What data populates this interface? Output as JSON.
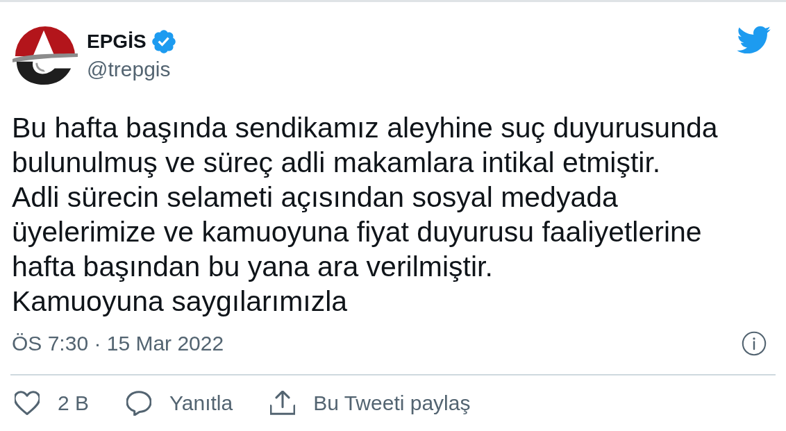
{
  "author": {
    "name": "EPGİS",
    "verified": true,
    "handle": "@trepgis"
  },
  "tweet": {
    "text_lines": [
      "Bu hafta başında sendikamız aleyhine suç duyurusunda",
      "bulunulmuş ve süreç adli makamlara intikal etmiştir.",
      "Adli sürecin selameti açısından sosyal medyada",
      "üyelerimize ve kamuoyuna fiyat duyurusu faaliyetlerine",
      "hafta başından bu yana ara verilmiştir.",
      "Kamuoyuna saygılarımızla"
    ],
    "timestamp": "ÖS 7:30 · 15 Mar 2022"
  },
  "actions": [
    {
      "kind": "like",
      "label": "2 B"
    },
    {
      "kind": "reply",
      "label": "Yanıtla"
    },
    {
      "kind": "share",
      "label": "Bu Tweeti paylaş"
    }
  ]
}
